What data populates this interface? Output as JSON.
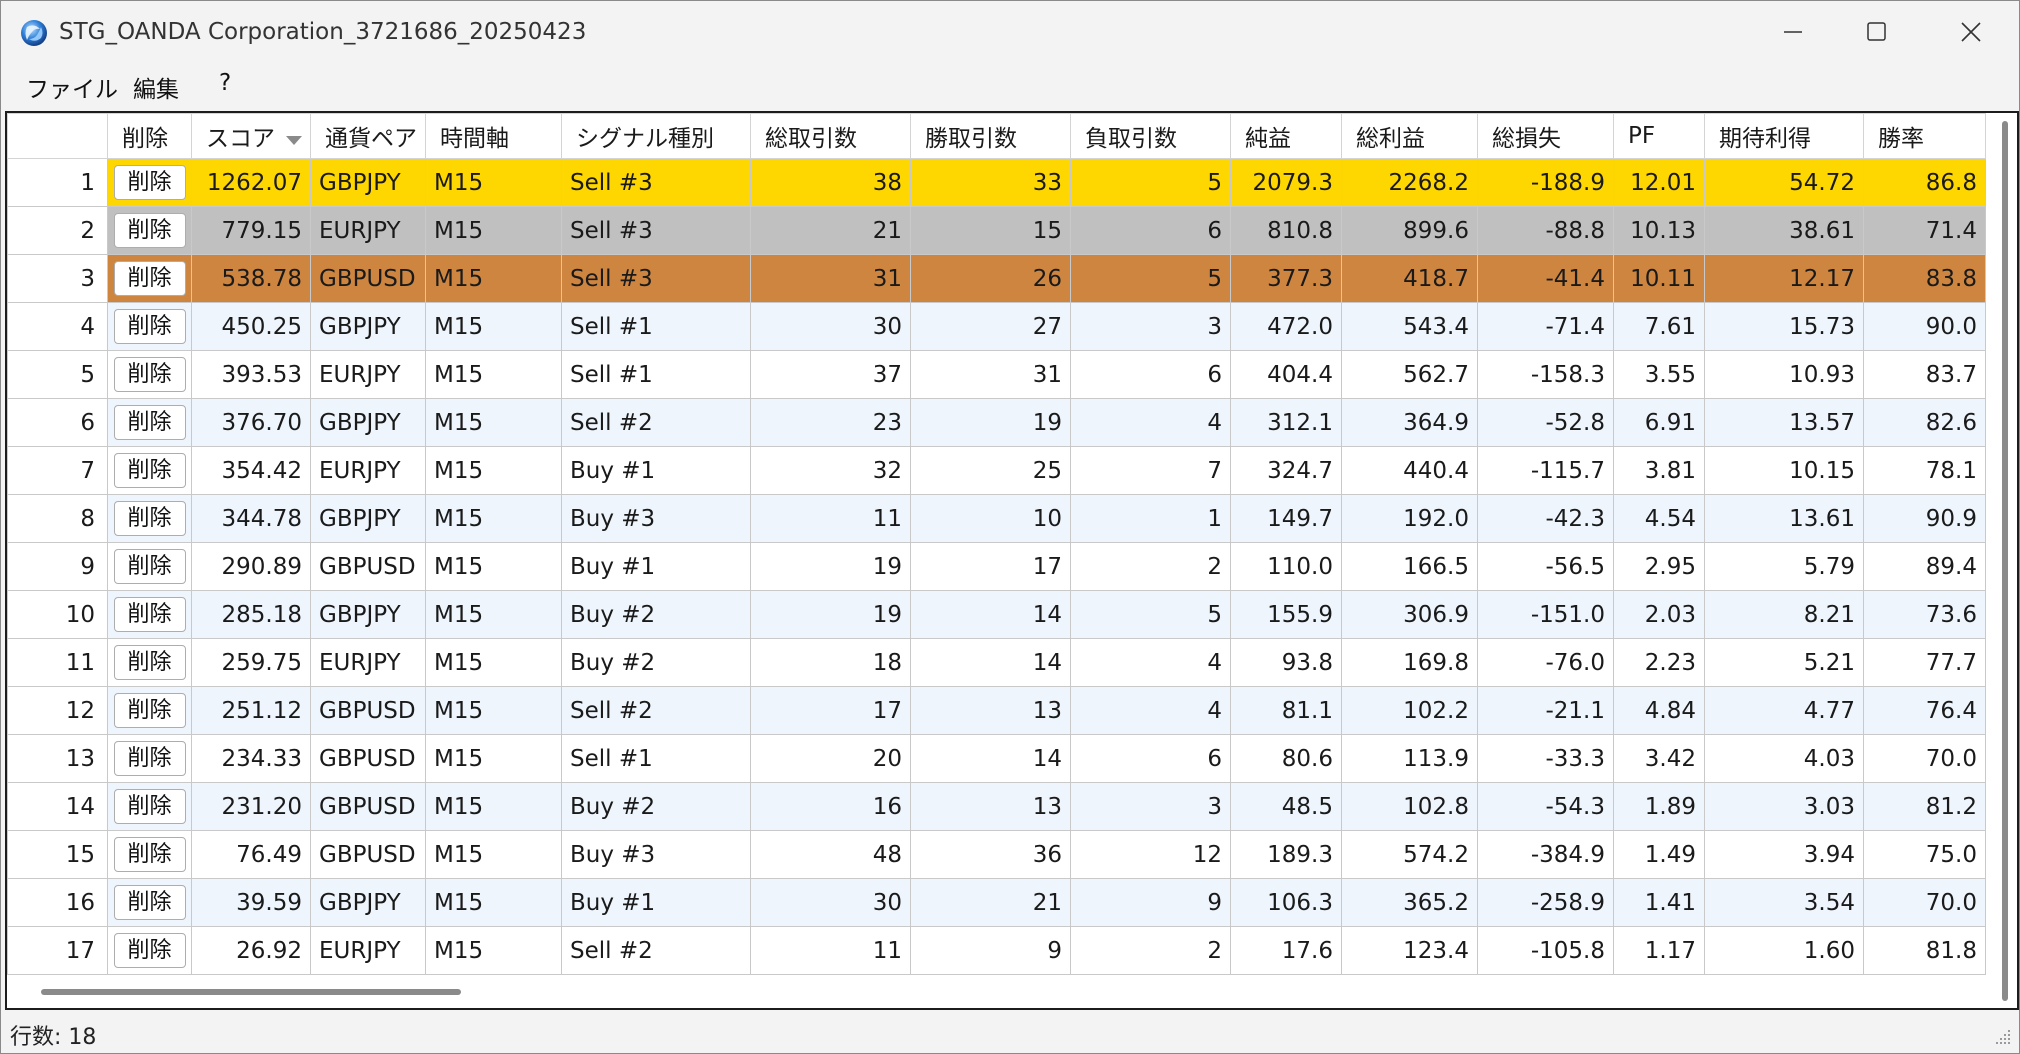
{
  "window": {
    "title": "STG_OANDA Corporation_3721686_20250423"
  },
  "menu": [
    "ファイル",
    "編集",
    "?"
  ],
  "columns": [
    "削除",
    "スコア",
    "通貨ペア",
    "時間軸",
    "シグナル種別",
    "総取引数",
    "勝取引数",
    "負取引数",
    "純益",
    "総利益",
    "総損失",
    "PF",
    "期待利得",
    "勝率"
  ],
  "delete_label": "削除",
  "colors": {
    "gold": "#ffd700",
    "silver": "#c0c0c0",
    "bronze": "#cd853f",
    "alt_row": "#eef5fd"
  },
  "rows": [
    [
      "1",
      "1262.07",
      "GBPJPY",
      "M15",
      "Sell #3",
      "38",
      "33",
      "5",
      "2079.3",
      "2268.2",
      "-188.9",
      "12.01",
      "54.72",
      "86.8"
    ],
    [
      "2",
      "779.15",
      "EURJPY",
      "M15",
      "Sell #3",
      "21",
      "15",
      "6",
      "810.8",
      "899.6",
      "-88.8",
      "10.13",
      "38.61",
      "71.4"
    ],
    [
      "3",
      "538.78",
      "GBPUSD",
      "M15",
      "Sell #3",
      "31",
      "26",
      "5",
      "377.3",
      "418.7",
      "-41.4",
      "10.11",
      "12.17",
      "83.8"
    ],
    [
      "4",
      "450.25",
      "GBPJPY",
      "M15",
      "Sell #1",
      "30",
      "27",
      "3",
      "472.0",
      "543.4",
      "-71.4",
      "7.61",
      "15.73",
      "90.0"
    ],
    [
      "5",
      "393.53",
      "EURJPY",
      "M15",
      "Sell #1",
      "37",
      "31",
      "6",
      "404.4",
      "562.7",
      "-158.3",
      "3.55",
      "10.93",
      "83.7"
    ],
    [
      "6",
      "376.70",
      "GBPJPY",
      "M15",
      "Sell #2",
      "23",
      "19",
      "4",
      "312.1",
      "364.9",
      "-52.8",
      "6.91",
      "13.57",
      "82.6"
    ],
    [
      "7",
      "354.42",
      "EURJPY",
      "M15",
      "Buy #1",
      "32",
      "25",
      "7",
      "324.7",
      "440.4",
      "-115.7",
      "3.81",
      "10.15",
      "78.1"
    ],
    [
      "8",
      "344.78",
      "GBPJPY",
      "M15",
      "Buy #3",
      "11",
      "10",
      "1",
      "149.7",
      "192.0",
      "-42.3",
      "4.54",
      "13.61",
      "90.9"
    ],
    [
      "9",
      "290.89",
      "GBPUSD",
      "M15",
      "Buy #1",
      "19",
      "17",
      "2",
      "110.0",
      "166.5",
      "-56.5",
      "2.95",
      "5.79",
      "89.4"
    ],
    [
      "10",
      "285.18",
      "GBPJPY",
      "M15",
      "Buy #2",
      "19",
      "14",
      "5",
      "155.9",
      "306.9",
      "-151.0",
      "2.03",
      "8.21",
      "73.6"
    ],
    [
      "11",
      "259.75",
      "EURJPY",
      "M15",
      "Buy #2",
      "18",
      "14",
      "4",
      "93.8",
      "169.8",
      "-76.0",
      "2.23",
      "5.21",
      "77.7"
    ],
    [
      "12",
      "251.12",
      "GBPUSD",
      "M15",
      "Sell #2",
      "17",
      "13",
      "4",
      "81.1",
      "102.2",
      "-21.1",
      "4.84",
      "4.77",
      "76.4"
    ],
    [
      "13",
      "234.33",
      "GBPUSD",
      "M15",
      "Sell #1",
      "20",
      "14",
      "6",
      "80.6",
      "113.9",
      "-33.3",
      "3.42",
      "4.03",
      "70.0"
    ],
    [
      "14",
      "231.20",
      "GBPUSD",
      "M15",
      "Buy #2",
      "16",
      "13",
      "3",
      "48.5",
      "102.8",
      "-54.3",
      "1.89",
      "3.03",
      "81.2"
    ],
    [
      "15",
      "76.49",
      "GBPUSD",
      "M15",
      "Buy #3",
      "48",
      "36",
      "12",
      "189.3",
      "574.2",
      "-384.9",
      "1.49",
      "3.94",
      "75.0"
    ],
    [
      "16",
      "39.59",
      "GBPJPY",
      "M15",
      "Buy #1",
      "30",
      "21",
      "9",
      "106.3",
      "365.2",
      "-258.9",
      "1.41",
      "3.54",
      "70.0"
    ],
    [
      "17",
      "26.92",
      "EURJPY",
      "M15",
      "Sell #2",
      "11",
      "9",
      "2",
      "17.6",
      "123.4",
      "-105.8",
      "1.17",
      "1.60",
      "81.8"
    ]
  ],
  "status": {
    "row_count": "行数: 18"
  }
}
